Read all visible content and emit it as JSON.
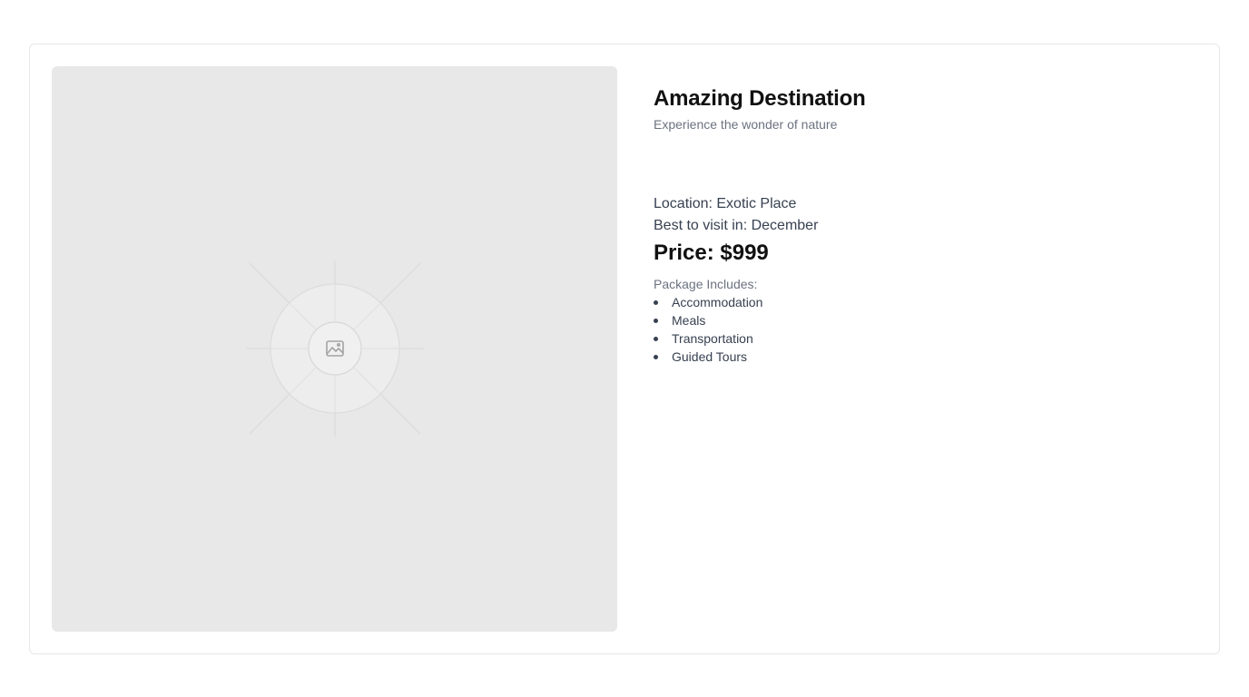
{
  "product": {
    "title": "Amazing Destination",
    "subtitle": "Experience the wonder of nature",
    "location_line": "Location: Exotic Place",
    "visit_line": "Best to visit in: December",
    "price_line": "Price: $999",
    "package_label": "Package Includes:",
    "package_items": [
      "Accommodation",
      "Meals",
      "Transportation",
      "Guided Tours"
    ]
  },
  "image": {
    "icon": "image-icon",
    "placeholder_color": "#e8e8e8"
  }
}
